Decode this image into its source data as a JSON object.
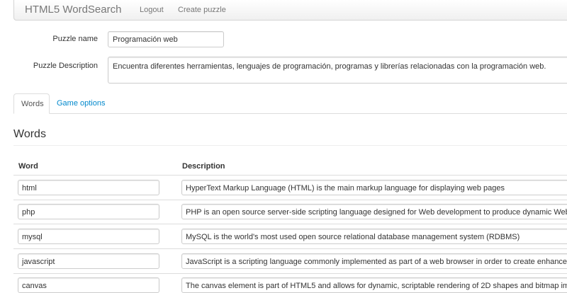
{
  "navbar": {
    "brand": "HTML5 WordSearch",
    "logout": "Logout",
    "create": "Create puzzle"
  },
  "form": {
    "name_label": "Puzzle name",
    "name_value": "Programación web",
    "desc_label": "Puzzle Description",
    "desc_value": "Encuentra diferentes herramientas, lenguajes de programación, programas y librerías relacionadas con la programación web."
  },
  "tabs": [
    {
      "label": "Words",
      "active": true
    },
    {
      "label": "Game options",
      "active": false
    }
  ],
  "section": {
    "title": "Words"
  },
  "table": {
    "headers": [
      "Word",
      "Description"
    ],
    "rows": [
      {
        "word": "html",
        "description": "HyperText Markup Language (HTML) is the main markup language for displaying web pages"
      },
      {
        "word": "php",
        "description": "PHP is an open source server-side scripting language designed for Web development to produce dynamic Web pages"
      },
      {
        "word": "mysql",
        "description": "MySQL is the world's most used open source relational database management system (RDBMS)"
      },
      {
        "word": "javascript",
        "description": "JavaScript is a scripting language commonly implemented as part of a web browser in order to create enhanced user interfaces"
      },
      {
        "word": "canvas",
        "description": "The canvas element is part of HTML5 and allows for dynamic, scriptable rendering of 2D shapes and bitmap images"
      }
    ]
  },
  "colors": {
    "link": "#0088cc",
    "muted": "#777777",
    "border": "#cccccc"
  }
}
